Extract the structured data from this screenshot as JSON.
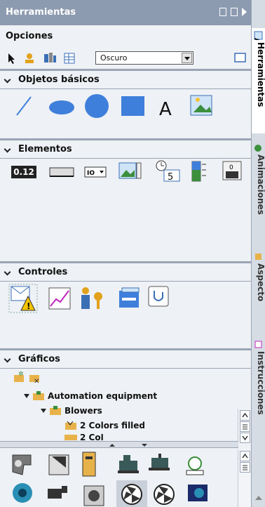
{
  "title": "Herramientas",
  "options": {
    "title": "Opciones",
    "theme_value": "Oscuro"
  },
  "sections": {
    "basic": "Objetos básicos",
    "elements": "Elementos",
    "controls": "Controles",
    "graphics": "Gráficos"
  },
  "elements": {
    "io_text": "0.12"
  },
  "tree": {
    "item1": "Automation equipment",
    "item2": "Blowers",
    "item3": "2 Colors filled",
    "item4": "2 Col"
  },
  "sidebar": {
    "tab1": "Herramientas",
    "tab2": "Animaciones",
    "tab3": "Aspecto",
    "tab4": "Instrucciones"
  },
  "colors": {
    "accent_blue": "#3f7fdc",
    "titlebar": "#8d9bb0"
  }
}
